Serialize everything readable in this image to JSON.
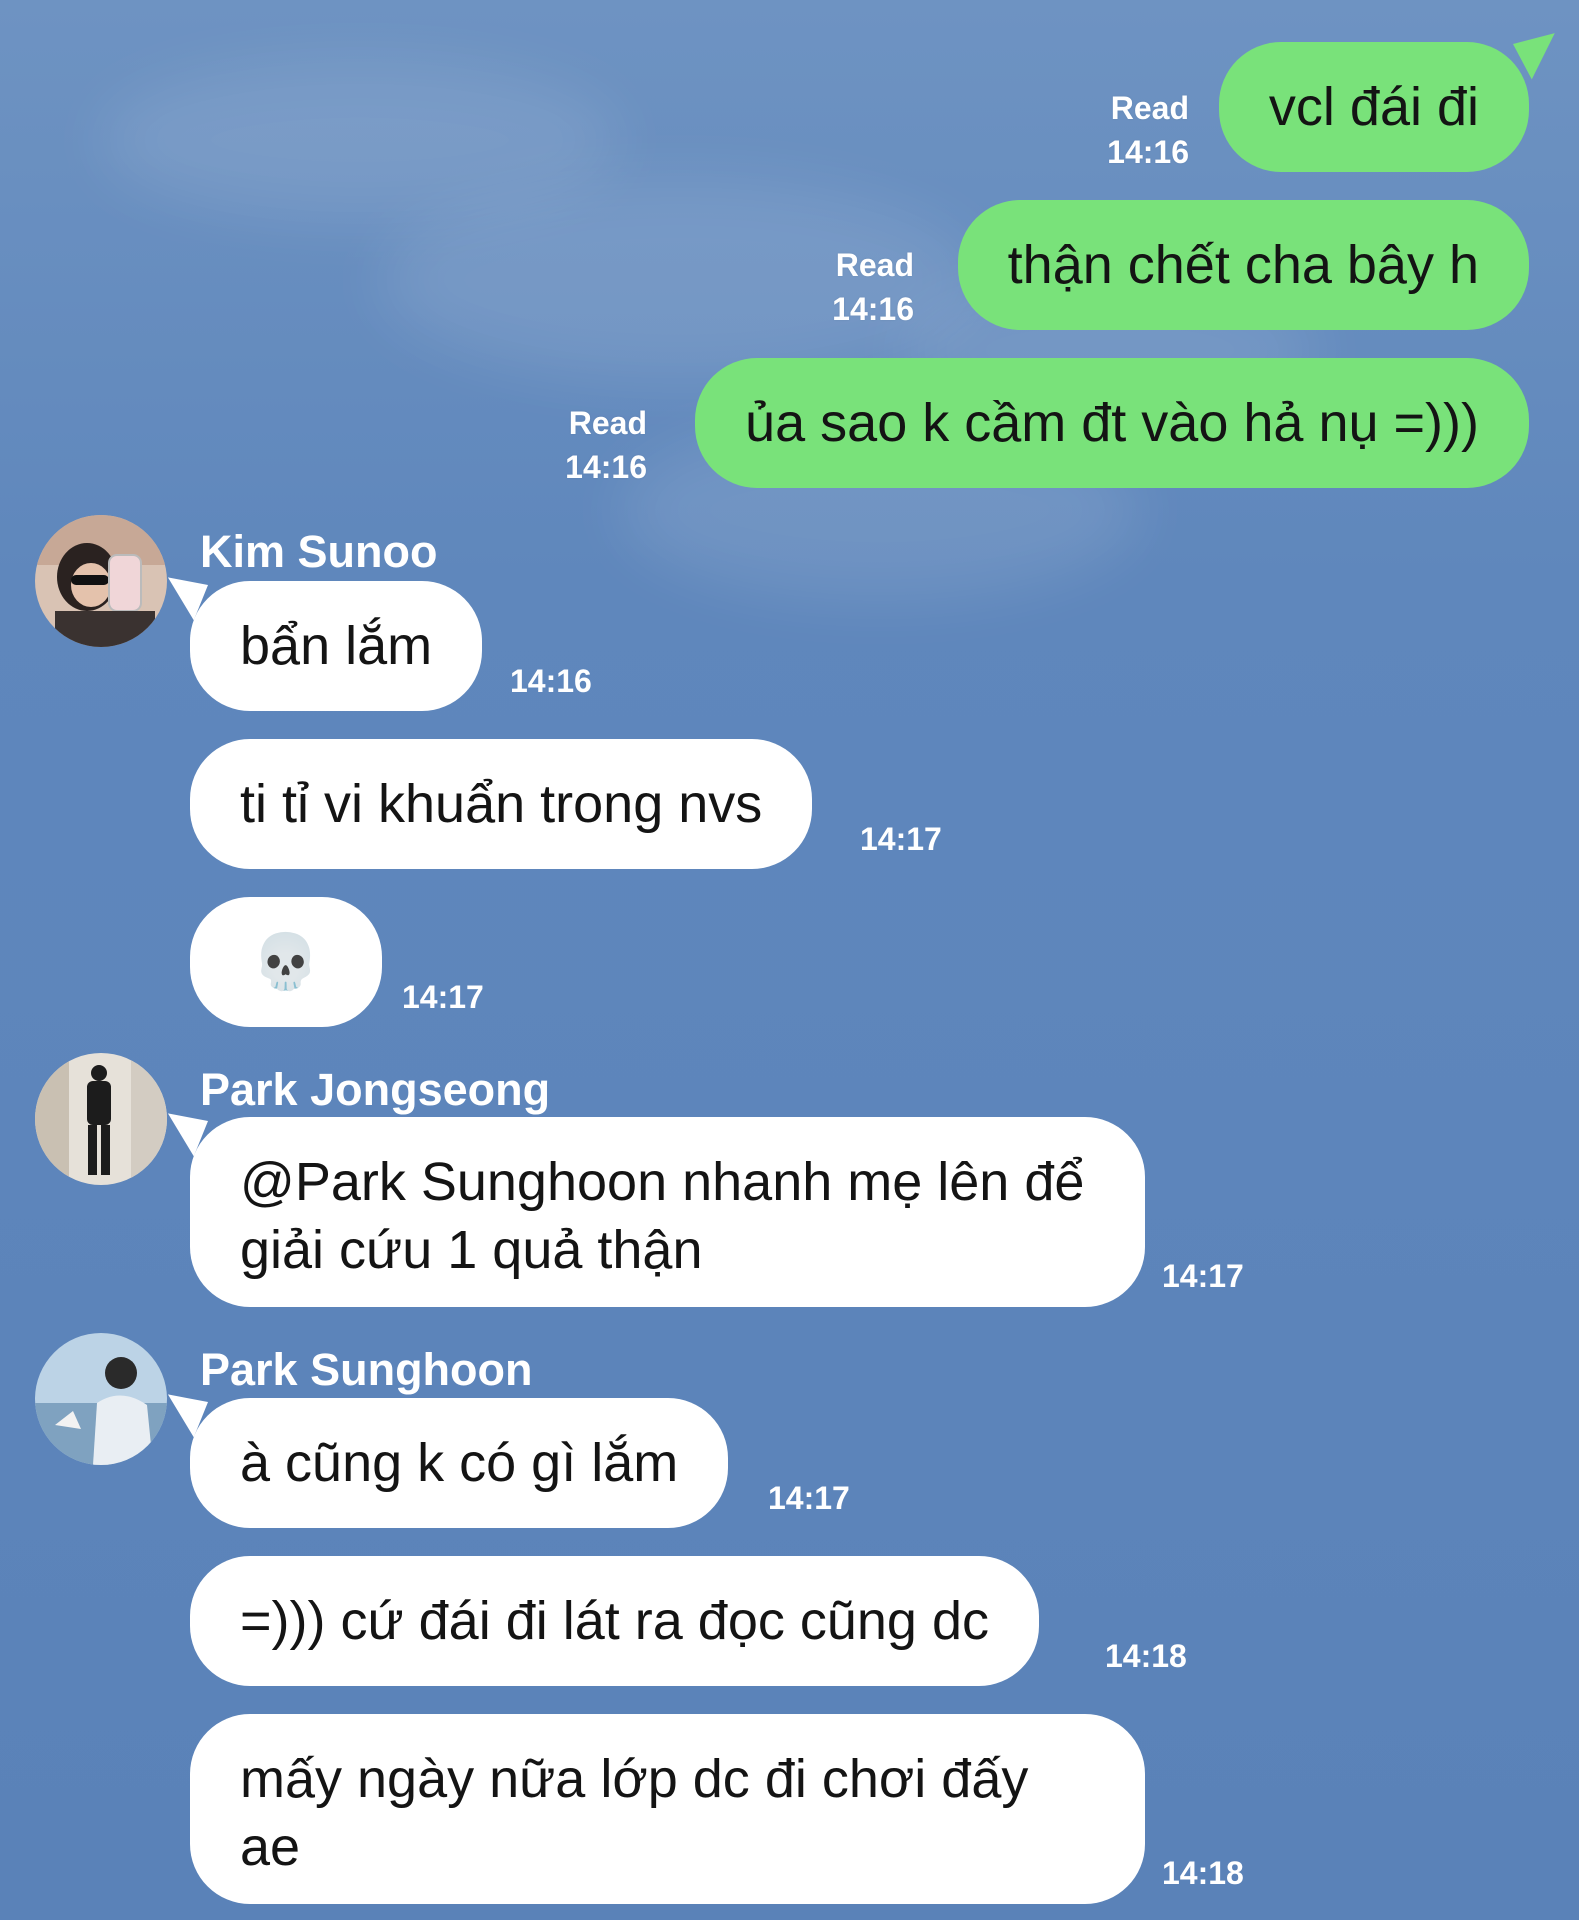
{
  "colors": {
    "background": "#5f87bc",
    "outgoing_bubble": "#79e27a",
    "incoming_bubble": "#ffffff",
    "meta_text": "#ffffff"
  },
  "outgoing": [
    {
      "text": "vcl đái đi",
      "status": "Read",
      "time": "14:16"
    },
    {
      "text": "thận chết cha bây h",
      "status": "Read",
      "time": "14:16"
    },
    {
      "text": "ủa sao k cầm đt vào hả nụ =)))",
      "status": "Read",
      "time": "14:16"
    }
  ],
  "groups": [
    {
      "sender": "Kim Sunoo",
      "avatar_icon": "profile-photo-mirror-selfie",
      "messages": [
        {
          "text": "bẩn lắm",
          "time": "14:16"
        },
        {
          "text": "ti tỉ vi khuẩn trong nvs",
          "time": "14:17"
        },
        {
          "text": "💀",
          "time": "14:17"
        }
      ]
    },
    {
      "sender": "Park Jongseong",
      "avatar_icon": "profile-photo-standing-figure",
      "messages": [
        {
          "text": "@Park Sunghoon nhanh mẹ lên để giải cứu 1 quả thận",
          "time": "14:17"
        }
      ]
    },
    {
      "sender": "Park Sunghoon",
      "avatar_icon": "profile-photo-sky-sea",
      "messages": [
        {
          "text": "à cũng k có gì lắm",
          "time": "14:17"
        },
        {
          "text": "=))) cứ đái đi lát ra đọc cũng dc",
          "time": "14:18"
        },
        {
          "text": "mấy ngày nữa lớp dc đi chơi đấy ae",
          "time": "14:18"
        }
      ]
    }
  ]
}
